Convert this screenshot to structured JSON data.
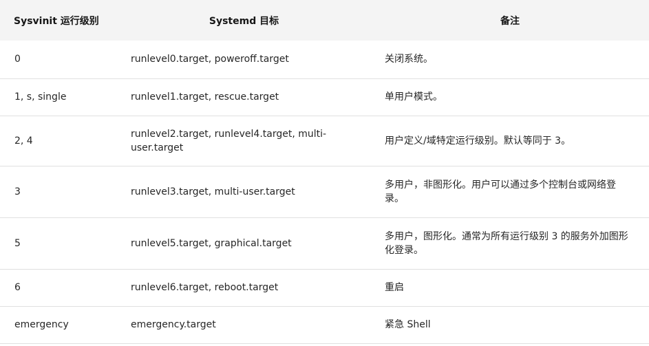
{
  "table": {
    "headers": {
      "sysvinit": "Sysvinit 运行级别",
      "systemd": "Systemd 目标",
      "notes": "备注"
    },
    "rows": [
      {
        "runlevel": "0",
        "target": "runlevel0.target, poweroff.target",
        "note": "关闭系统。"
      },
      {
        "runlevel": "1, s, single",
        "target": "runlevel1.target, rescue.target",
        "note": "单用户模式。"
      },
      {
        "runlevel": "2, 4",
        "target": "runlevel2.target, runlevel4.target, multi-user.target",
        "note": "用户定义/域特定运行级别。默认等同于 3。"
      },
      {
        "runlevel": "3",
        "target": "runlevel3.target, multi-user.target",
        "note": "多用户，非图形化。用户可以通过多个控制台或网络登录。"
      },
      {
        "runlevel": "5",
        "target": "runlevel5.target, graphical.target",
        "note": "多用户，图形化。通常为所有运行级别 3 的服务外加图形化登录。"
      },
      {
        "runlevel": "6",
        "target": "runlevel6.target, reboot.target",
        "note": "重启"
      },
      {
        "runlevel": "emergency",
        "target": "emergency.target",
        "note": "紧急 Shell"
      }
    ]
  }
}
